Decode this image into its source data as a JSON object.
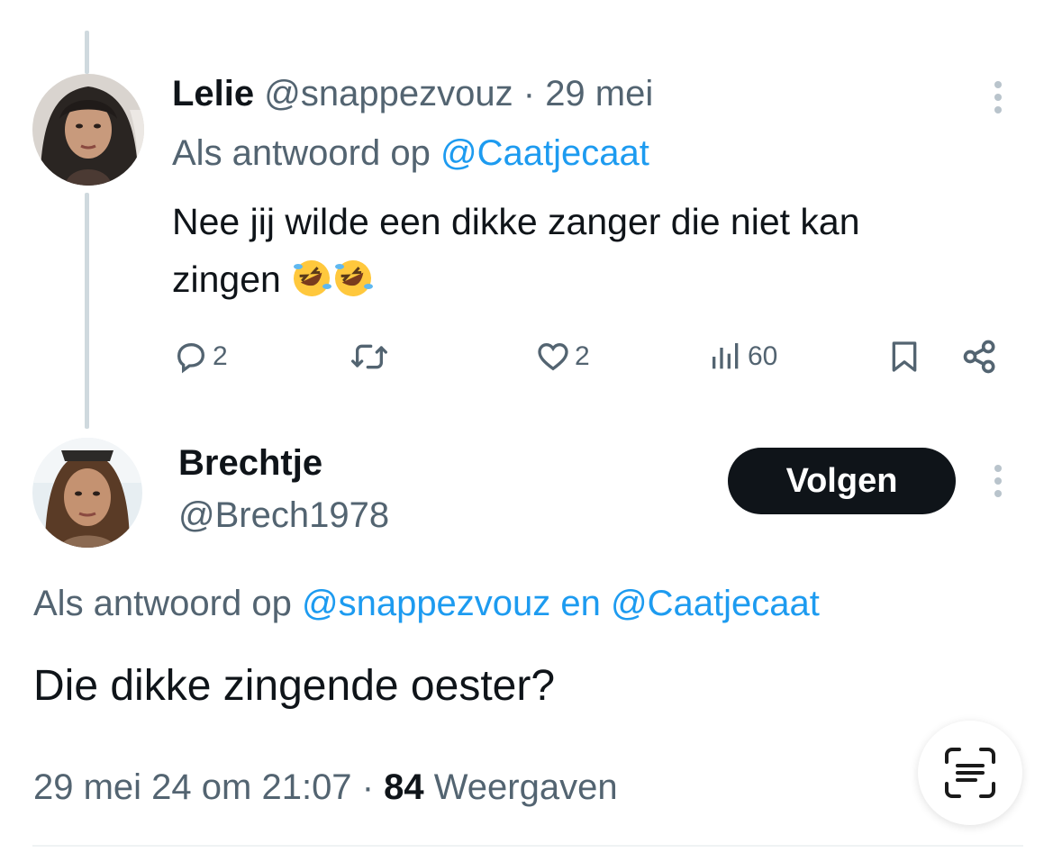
{
  "tweet1": {
    "name": "Lelie",
    "handle": "@snappezvouz",
    "separator": "·",
    "date": "29 mei",
    "reply_prefix": "Als antwoord op",
    "reply_to": "@Caatjecaat",
    "text_line1": "Nee jij wilde een dikke zanger die niet kan",
    "text_line2": "zingen",
    "emoji": [
      "rolling-on-floor-laughing-emoji",
      "rolling-on-floor-laughing-emoji"
    ],
    "actions": {
      "replies": "2",
      "likes": "2",
      "views": "60"
    }
  },
  "tweet2": {
    "name": "Brechtje",
    "handle": "@Brech1978",
    "follow_label": "Volgen",
    "reply_prefix": "Als antwoord op",
    "reply_to_1": "@snappezvouz",
    "reply_joiner": "en",
    "reply_to_2": "@Caatjecaat",
    "text": "Die dikke zingende oester?",
    "timestamp": "29 mei 24 om 21:07",
    "separator": "·",
    "views_count": "84",
    "views_label": "Weergaven"
  },
  "colors": {
    "link": "#1d9bf0",
    "muted": "#536471",
    "text": "#0f1419",
    "button_bg": "#0f1419"
  }
}
